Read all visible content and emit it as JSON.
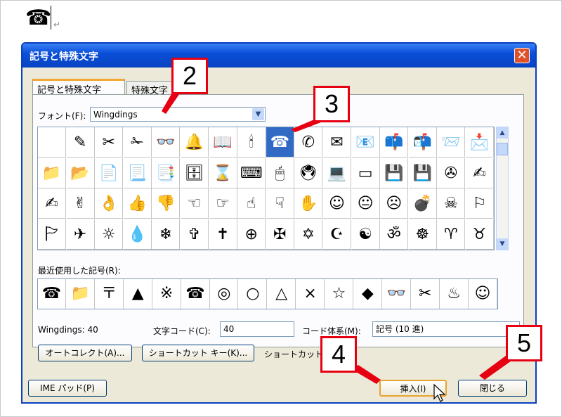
{
  "document": {
    "glyph": "☎",
    "paragraph_mark": "↵"
  },
  "dialog": {
    "title": "記号と特殊文字",
    "close": "✕",
    "tabs": [
      "記号と特殊文字",
      "特殊文字"
    ],
    "font_label": "フォント(F):",
    "font_value": "Wingdings",
    "symbols": [
      [
        " ",
        "✎",
        "✂",
        "✁",
        "👓",
        "🔔",
        "📖",
        "🕯",
        "☎",
        "✆",
        "✉",
        "📧",
        "📫",
        "📬",
        "📨",
        "📩"
      ],
      [
        "📁",
        "📂",
        "📄",
        "📃",
        "📑",
        "🗄",
        "⌛",
        "⌨",
        "🖱",
        "🖲",
        "💻",
        "▭",
        "💾",
        "💾",
        "✇",
        "✍"
      ],
      [
        "✍",
        "✌",
        "👌",
        "👍",
        "👎",
        "☜",
        "☞",
        "☝",
        "☟",
        "✋",
        "☺",
        "😐",
        "☹",
        "💣",
        "☠",
        "⚐"
      ],
      [
        "🏱",
        "✈",
        "☼",
        "💧",
        "❄",
        "✞",
        "✝",
        "⊕",
        "✠",
        "✡",
        "☪",
        "☯",
        "ॐ",
        "☸",
        "♈",
        "♉"
      ]
    ],
    "selected_symbol": "☎",
    "recent_label": "最近使用した記号(R):",
    "recent": [
      "☎",
      "📁",
      "〒",
      "▲",
      "※",
      "☎",
      "◎",
      "○",
      "△",
      "×",
      "☆",
      "◆",
      "👓",
      "✂",
      "♨",
      "☺"
    ],
    "font_info": "Wingdings: 40",
    "charcode_label": "文字コード(C):",
    "charcode_value": "40",
    "charset_label": "コード体系(M):",
    "charset_value": "記号 (10 進)",
    "autocorrect_button": "オートコレクト(A)...",
    "shortcut_button": "ショートカット キー(K)...",
    "shortcut_text": "ショートカット",
    "ime_button": "IME パッド(P)",
    "insert_button": "挿入(I)",
    "close_button": "閉じる"
  },
  "callouts": [
    "2",
    "3",
    "4",
    "5"
  ]
}
